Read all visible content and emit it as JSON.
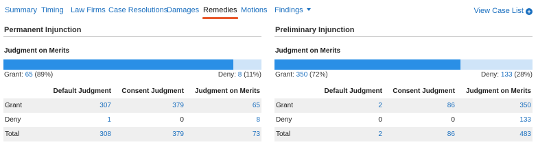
{
  "nav": {
    "tabs": [
      "Summary",
      "Timing",
      "Law Firms",
      "Case Resolutions",
      "Damages",
      "Remedies",
      "Motions",
      "Findings"
    ],
    "active_tab": "Remedies",
    "view_case_list": "View Case List"
  },
  "panels": [
    {
      "title": "Permanent Injunction",
      "subtitle": "Judgment on Merits",
      "grant_label": "Grant:",
      "grant_count": "65",
      "grant_pct": "(89%)",
      "deny_label": "Deny:",
      "deny_count": "8",
      "deny_pct": "(11%)",
      "grant_fraction": 0.89,
      "headers": [
        "",
        "Default Judgment",
        "Consent Judgment",
        "Judgment on Merits"
      ],
      "rows": [
        {
          "label": "Grant",
          "values": [
            "307",
            "379",
            "65"
          ],
          "links": [
            true,
            true,
            true
          ]
        },
        {
          "label": "Deny",
          "values": [
            "1",
            "0",
            "8"
          ],
          "links": [
            true,
            false,
            true
          ]
        },
        {
          "label": "Total",
          "values": [
            "308",
            "379",
            "73"
          ],
          "links": [
            true,
            true,
            true
          ]
        }
      ]
    },
    {
      "title": "Preliminary Injunction",
      "subtitle": "Judgment on Merits",
      "grant_label": "Grant:",
      "grant_count": "350",
      "grant_pct": "(72%)",
      "deny_label": "Deny:",
      "deny_count": "133",
      "deny_pct": "(28%)",
      "grant_fraction": 0.72,
      "headers": [
        "",
        "Default Judgment",
        "Consent Judgment",
        "Judgment on Merits"
      ],
      "rows": [
        {
          "label": "Grant",
          "values": [
            "2",
            "86",
            "350"
          ],
          "links": [
            true,
            true,
            true
          ]
        },
        {
          "label": "Deny",
          "values": [
            "0",
            "0",
            "133"
          ],
          "links": [
            false,
            false,
            true
          ]
        },
        {
          "label": "Total",
          "values": [
            "2",
            "86",
            "483"
          ],
          "links": [
            true,
            true,
            true
          ]
        }
      ]
    }
  ]
}
